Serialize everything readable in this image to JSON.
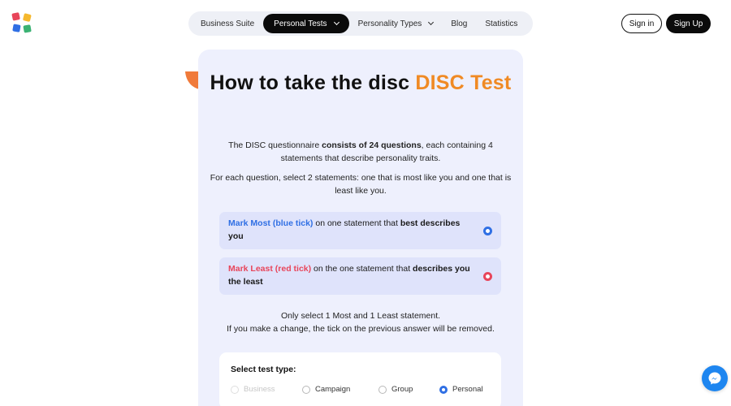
{
  "nav": {
    "items": [
      {
        "label": "Business Suite",
        "dropdown": false,
        "active": false
      },
      {
        "label": "Personal Tests",
        "dropdown": true,
        "active": true
      },
      {
        "label": "Personality Types",
        "dropdown": true,
        "active": false
      },
      {
        "label": "Blog",
        "dropdown": false,
        "active": false
      },
      {
        "label": "Statistics",
        "dropdown": false,
        "active": false
      }
    ]
  },
  "auth": {
    "signin_label": "Sign in",
    "signup_label": "Sign Up"
  },
  "card": {
    "title_part1": "How to take the disc ",
    "title_accent": "DISC Test",
    "intro_pre": "The DISC questionnaire ",
    "intro_bold": "consists of 24 questions",
    "intro_post": ", each containing 4 statements that describe personality traits.",
    "instruction": "For each question, select 2 statements: one that is most like you and one that is least like you.",
    "most": {
      "label": "Mark Most (blue tick)",
      "mid": " on one statement that ",
      "bold": "best describes you"
    },
    "least": {
      "label": "Mark Least (red tick)",
      "mid": " on the one statement that ",
      "bold": "describes you the least"
    },
    "note_line1": "Only select 1 Most and 1 Least statement.",
    "note_line2": "If you make a change, the tick on the previous answer will be removed.",
    "test_type": {
      "title": "Select test type:",
      "options": [
        {
          "label": "Business",
          "state": "disabled"
        },
        {
          "label": "Campaign",
          "state": "unchecked"
        },
        {
          "label": "Group",
          "state": "unchecked"
        },
        {
          "label": "Personal",
          "state": "checked"
        }
      ]
    }
  },
  "colors": {
    "accent_orange": "#f08a24",
    "most_blue": "#2f6fe4",
    "least_red": "#e8455a",
    "card_bg": "#eef0fd",
    "messenger_blue": "#1e86f0"
  },
  "icons": {
    "logo": "disc-logo",
    "messenger": "messenger-icon",
    "chevron": "chevron-down-icon"
  }
}
